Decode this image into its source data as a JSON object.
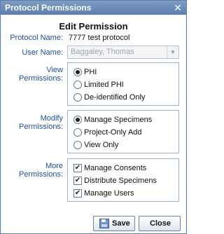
{
  "window": {
    "title": "Protocol Permissions",
    "close_glyph": "✕"
  },
  "heading": "Edit Permission",
  "protocol": {
    "label": "Protocol Name:",
    "value": "7777 test protocol"
  },
  "user": {
    "label": "User Name:",
    "value": "Baggaley, Thomas",
    "dropdown_glyph": "▼"
  },
  "view_permissions": {
    "label": "View Permissions:",
    "options": [
      {
        "label": "PHI",
        "selected": true
      },
      {
        "label": "Limited PHI",
        "selected": false
      },
      {
        "label": "De-identified Only",
        "selected": false
      }
    ]
  },
  "modify_permissions": {
    "label": "Modify Permissions:",
    "options": [
      {
        "label": "Manage Specimens",
        "selected": true
      },
      {
        "label": "Project-Only Add",
        "selected": false
      },
      {
        "label": "View Only",
        "selected": false
      }
    ]
  },
  "more_permissions": {
    "label": "More Permissions:",
    "options": [
      {
        "label": "Manage Consents",
        "checked": true
      },
      {
        "label": "Distribute Specimens",
        "checked": true
      },
      {
        "label": "Manage Users",
        "checked": true
      }
    ],
    "check_glyph": "✔"
  },
  "buttons": {
    "save": "Save",
    "close": "Close"
  }
}
